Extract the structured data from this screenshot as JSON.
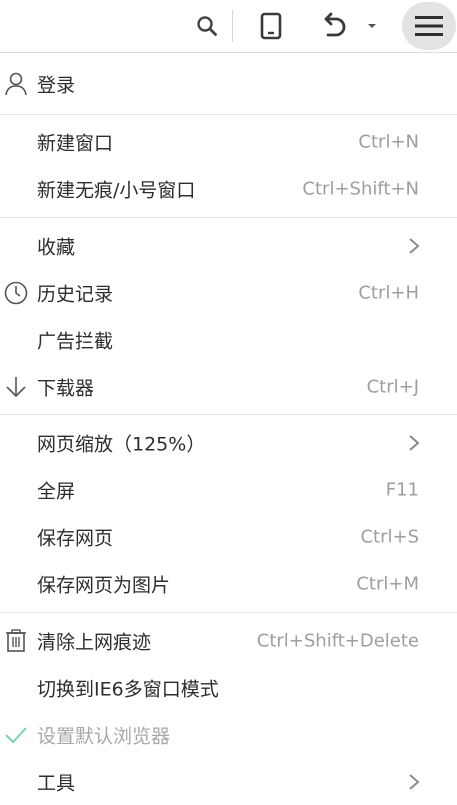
{
  "toolbar": {
    "icons": [
      "search-icon",
      "mobile-device-icon",
      "undo-icon",
      "dropdown-caret-icon",
      "hamburger-menu-icon"
    ]
  },
  "menu": {
    "login": {
      "label": "登录",
      "icon": "user-icon"
    },
    "new_window": {
      "label": "新建窗口",
      "shortcut": "Ctrl+N"
    },
    "new_private": {
      "label": "新建无痕/小号窗口",
      "shortcut": "Ctrl+Shift+N"
    },
    "favorites": {
      "label": "收藏"
    },
    "history": {
      "label": "历史记录",
      "shortcut": "Ctrl+H",
      "icon": "clock-icon"
    },
    "adblock": {
      "label": "广告拦截"
    },
    "downloads": {
      "label": "下载器",
      "shortcut": "Ctrl+J",
      "icon": "download-arrow-icon"
    },
    "zoom": {
      "label": "网页缩放（125%）"
    },
    "fullscreen": {
      "label": "全屏",
      "shortcut": "F11"
    },
    "save_page": {
      "label": "保存网页",
      "shortcut": "Ctrl+S"
    },
    "save_as_image": {
      "label": "保存网页为图片",
      "shortcut": "Ctrl+M"
    },
    "clear_traces": {
      "label": "清除上网痕迹",
      "shortcut": "Ctrl+Shift+Delete",
      "icon": "trash-icon"
    },
    "ie6_mode": {
      "label": "切换到IE6多窗口模式"
    },
    "default_browser": {
      "label": "设置默认浏览器",
      "icon": "checkmark-icon",
      "checkmark_color": "#7dd3a8"
    },
    "tools": {
      "label": "工具"
    }
  },
  "colors": {
    "menu_button_bg": "#e3e3e3",
    "separator": "#e6e6e6",
    "shortcut_text": "#9e9e9e",
    "disabled_text": "#a9a9a9"
  }
}
